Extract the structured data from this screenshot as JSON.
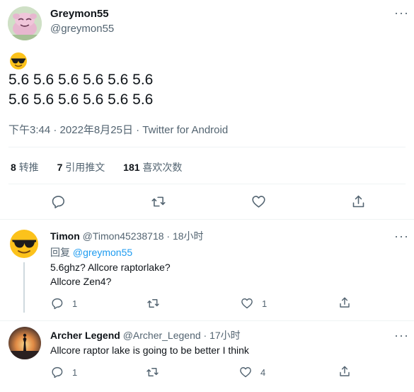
{
  "main_tweet": {
    "author_name": "Greymon55",
    "author_handle": "@greymon55",
    "emoji": "😎",
    "body_line1": "5.6 5.6 5.6 5.6 5.6 5.6",
    "body_line2": "5.6 5.6 5.6 5.6 5.6 5.6",
    "meta_time": "下午3:44",
    "meta_dot1": "·",
    "meta_date": "2022年8月25日",
    "meta_dot2": "·",
    "meta_source": "Twitter for Android",
    "stats": {
      "retweets_count": "8",
      "retweets_label": "转推",
      "quotes_count": "7",
      "quotes_label": "引用推文",
      "likes_count": "181",
      "likes_label": "喜欢次数"
    },
    "more_glyph": "···"
  },
  "replies": [
    {
      "author_name": "Timon",
      "author_handle": "@Timon45238718",
      "dot": "·",
      "time": "18小时",
      "reply_prefix": "回复",
      "reply_to": "@greymon55",
      "line1": "5.6ghz? Allcore raptorlake?",
      "line2": "Allcore Zen4?",
      "reply_count": "1",
      "retweet_count": "",
      "like_count": "1",
      "more_glyph": "···"
    },
    {
      "author_name": "Archer Legend",
      "author_handle": "@Archer_Legend",
      "dot": "·",
      "time": "17小时",
      "line1": "Allcore raptor lake is going to be better I think",
      "reply_count": "1",
      "retweet_count": "",
      "like_count": "4",
      "more_glyph": "···"
    }
  ],
  "colors": {
    "accent": "#1d9bf0",
    "text": "#0f1419",
    "muted": "#536471",
    "divider": "#eff3f4"
  },
  "icons": [
    "reply-icon",
    "retweet-icon",
    "like-icon",
    "share-icon",
    "more-icon"
  ]
}
